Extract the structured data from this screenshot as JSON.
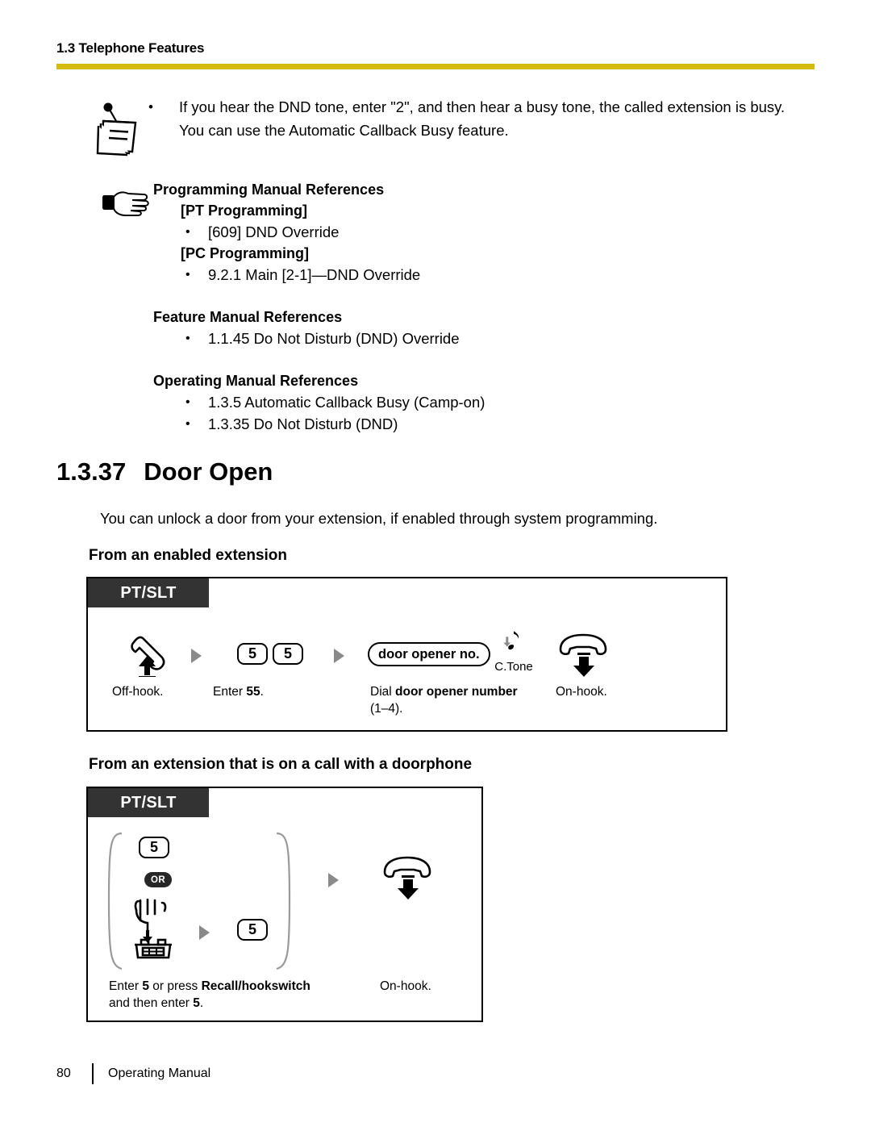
{
  "header": {
    "title": "1.3 Telephone Features",
    "rule_color": "#D4BC0E"
  },
  "note": {
    "icon": "note-memo-icon",
    "bullet": "•",
    "text": "If you hear the DND tone, enter \"2\", and then hear a busy tone, the called extension is busy. You can use the Automatic Callback Busy feature."
  },
  "references": {
    "icon": "pointing-hand-icon",
    "groups": [
      {
        "heading": "Programming Manual References",
        "subheadings": [
          {
            "label": "[PT Programming]",
            "items": [
              "[609] DND Override"
            ]
          },
          {
            "label": "[PC Programming]",
            "items": [
              "9.2.1 Main [2-1]—DND Override"
            ]
          }
        ]
      },
      {
        "heading": "Feature Manual References",
        "items": [
          "1.1.45 Do Not Disturb (DND) Override"
        ]
      },
      {
        "heading": "Operating Manual References",
        "items": [
          "1.3.5 Automatic Callback Busy (Camp-on)",
          "1.3.35 Do Not Disturb (DND)"
        ]
      }
    ]
  },
  "section": {
    "number": "1.3.37",
    "title": "Door Open",
    "intro": "You can unlock a door from your extension, if enabled through system programming.",
    "subsection_one": "From an enabled extension",
    "subsection_two": "From an extension that is on a call with a doorphone"
  },
  "diagram_one": {
    "banner": "PT/SLT",
    "keys": [
      "5",
      "5"
    ],
    "pill_label": "door opener no.",
    "tone_label": "C.Tone",
    "captions": {
      "off_hook": "Off-hook.",
      "enter_lead": "Enter ",
      "enter_bold": "55",
      "enter_tail": ".",
      "dial_lead": "Dial ",
      "dial_bold": "door opener number",
      "dial_tail": " (1–4).",
      "on_hook": "On-hook."
    }
  },
  "diagram_two": {
    "banner": "PT/SLT",
    "key_top": "5",
    "or_label": "OR",
    "key_bottom": "5",
    "captions": {
      "enter_lead": "Enter ",
      "enter_bold_1": "5",
      "enter_mid": " or press ",
      "enter_bold_2": "Recall/hookswitch",
      "enter_line2_lead": "and then enter ",
      "enter_bold_3": "5",
      "enter_line2_tail": ".",
      "on_hook": "On-hook."
    }
  },
  "footer": {
    "page_number": "80",
    "label": "Operating Manual"
  }
}
